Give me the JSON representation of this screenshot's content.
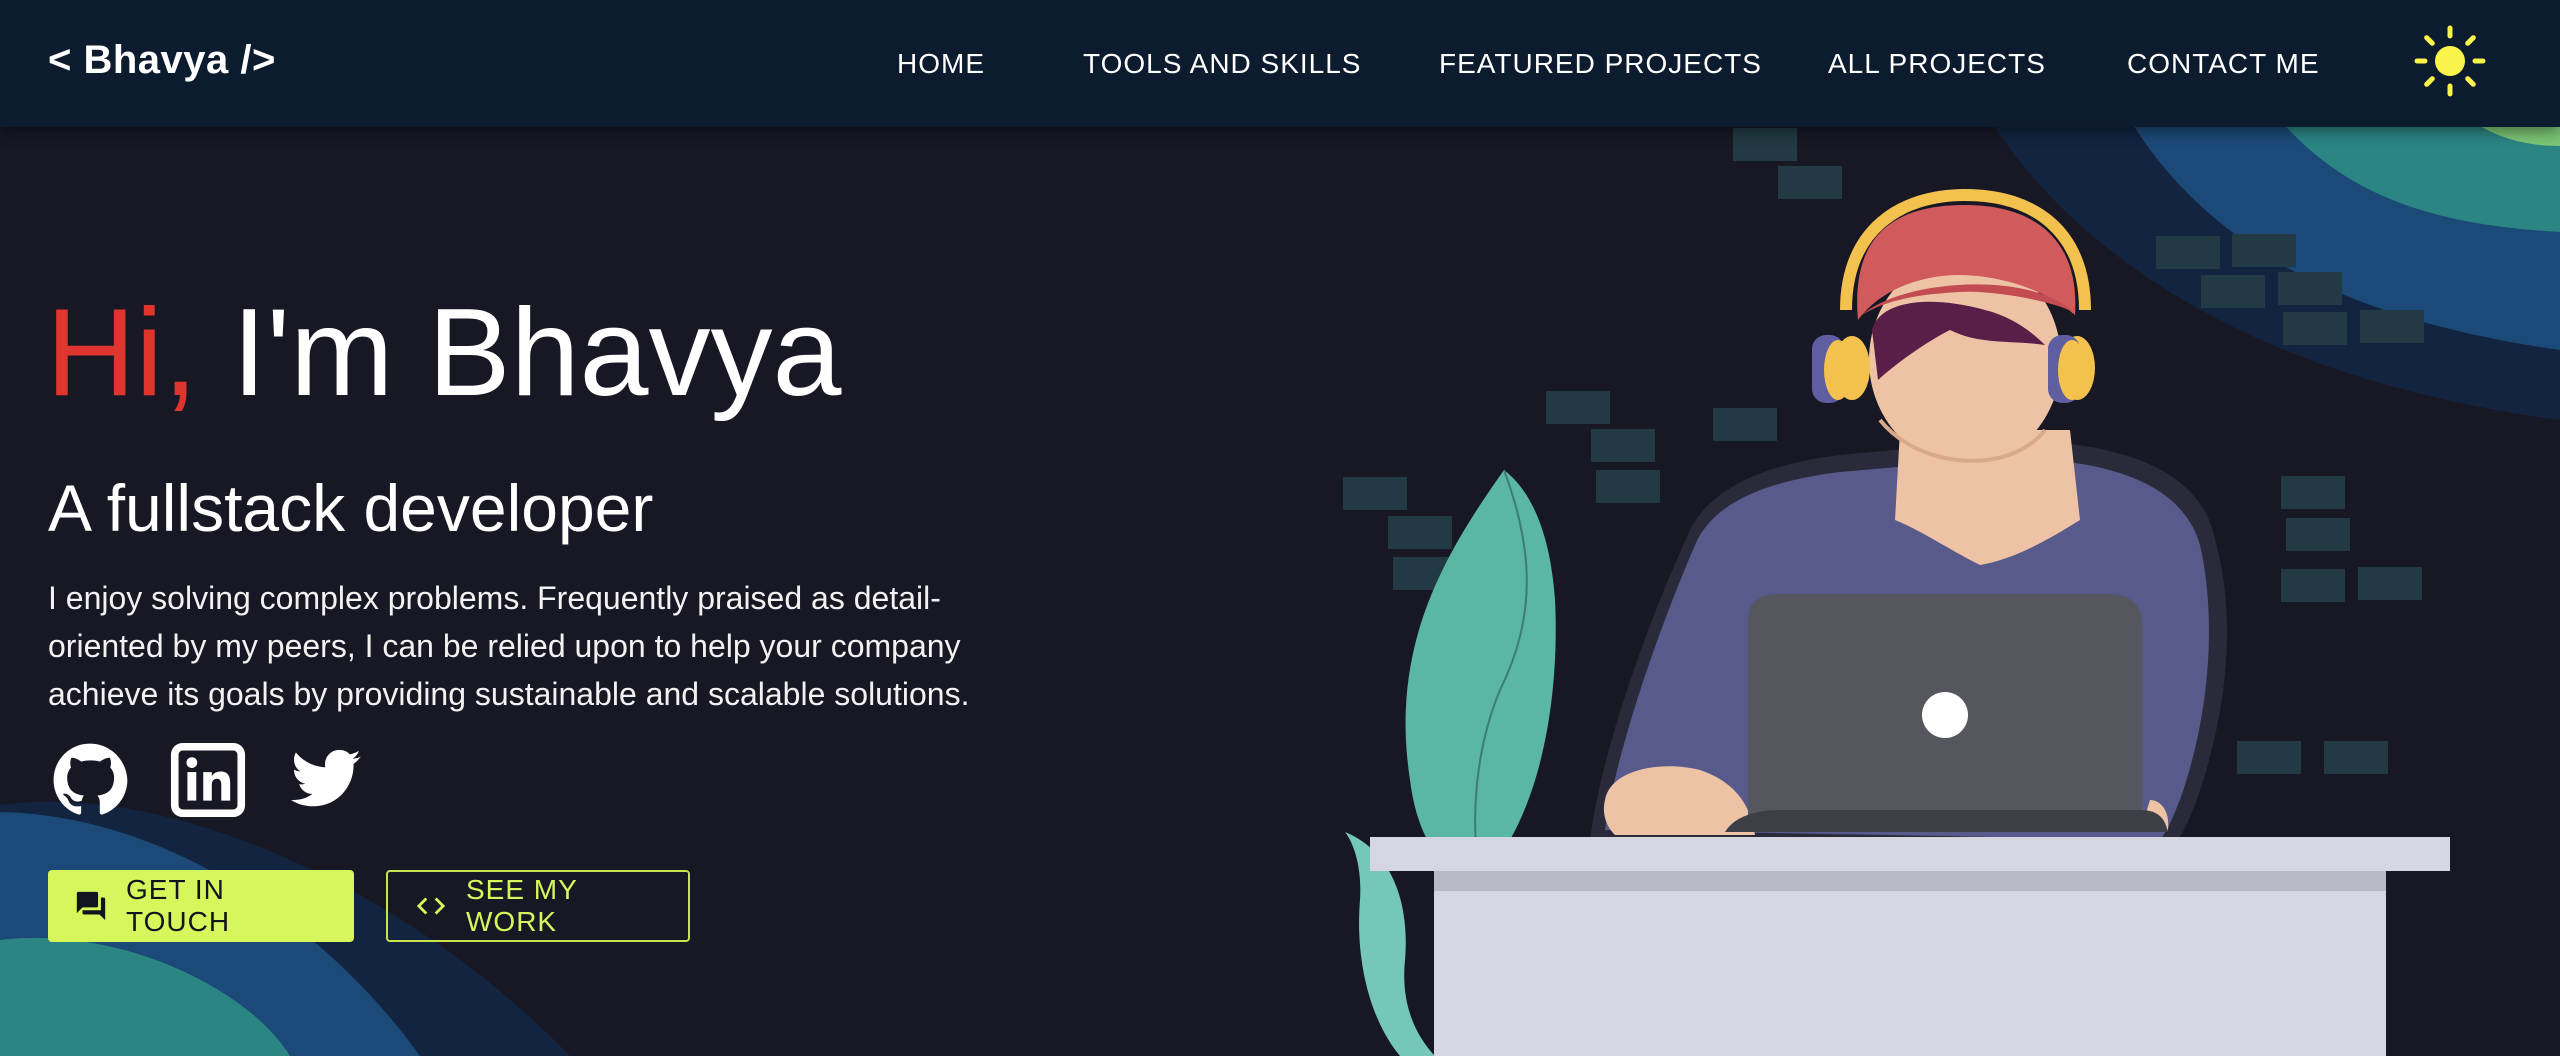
{
  "navbar": {
    "brand": "< Bhavya />",
    "items": [
      {
        "label": "HOME"
      },
      {
        "label": "TOOLS AND SKILLS"
      },
      {
        "label": "FEATURED PROJECTS"
      },
      {
        "label": "ALL PROJECTS"
      },
      {
        "label": "CONTACT ME"
      }
    ],
    "theme_icon": "sun-icon"
  },
  "hero": {
    "greeting": "Hi,",
    "name": "I'm Bhavya",
    "subtitle": "A fullstack developer",
    "description": "I enjoy solving complex problems. Frequently praised as detail-oriented by my peers, I can be relied upon to help your company achieve its goals by providing sustainable and scalable solutions."
  },
  "social": [
    {
      "icon": "github-icon"
    },
    {
      "icon": "linkedin-icon"
    },
    {
      "icon": "twitter-icon"
    }
  ],
  "buttons": {
    "primary": {
      "label": "GET IN TOUCH",
      "icon": "chat-icon"
    },
    "secondary": {
      "label": "SEE MY WORK",
      "icon": "code-icon"
    }
  },
  "colors": {
    "background": "#181825",
    "navbar": "#0d1b2f",
    "accent": "#d6f75b",
    "greeting": "#e0342f",
    "sun": "#f8f449"
  }
}
